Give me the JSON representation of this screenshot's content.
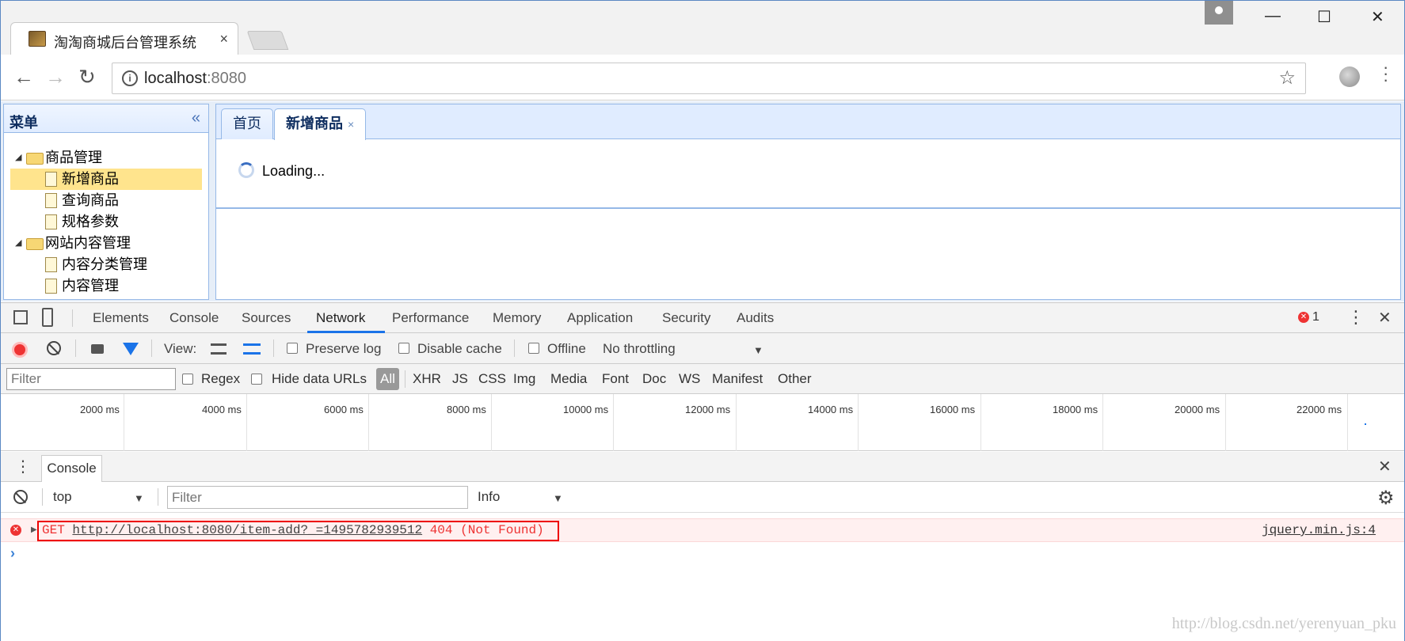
{
  "browser": {
    "tab_title": "淘淘商城后台管理系统",
    "tab_close": "×",
    "url_host": "localhost",
    "url_port": ":8080",
    "star": "☆",
    "back": "←",
    "forward": "→",
    "reload": "↻",
    "minimize": "—",
    "maximize": "☐",
    "close": "✕"
  },
  "sidebar": {
    "title": "菜单",
    "collapse_icon": "«",
    "tree": [
      {
        "label": "商品管理",
        "type": "folder",
        "level": 0,
        "arrow": "◢"
      },
      {
        "label": "新增商品",
        "type": "file",
        "level": 1,
        "selected": true
      },
      {
        "label": "查询商品",
        "type": "file",
        "level": 1
      },
      {
        "label": "规格参数",
        "type": "file",
        "level": 1
      },
      {
        "label": "网站内容管理",
        "type": "folder",
        "level": 0,
        "arrow": "◢"
      },
      {
        "label": "内容分类管理",
        "type": "file",
        "level": 1
      },
      {
        "label": "内容管理",
        "type": "file",
        "level": 1
      }
    ]
  },
  "main": {
    "tabs": [
      {
        "label": "首页",
        "active": false
      },
      {
        "label": "新增商品",
        "active": true,
        "close": "×"
      }
    ],
    "loading_text": "Loading..."
  },
  "devtools": {
    "tabs": [
      "Elements",
      "Console",
      "Sources",
      "Network",
      "Performance",
      "Memory",
      "Application",
      "Security",
      "Audits"
    ],
    "active_tab": "Network",
    "error_count": "1",
    "error_badge": "✕",
    "kebab": "⋮",
    "close": "✕",
    "network_toolbar": {
      "view_label": "View:",
      "preserve_log": "Preserve log",
      "disable_cache": "Disable cache",
      "offline": "Offline",
      "throttling": "No throttling",
      "caret": "▼"
    },
    "filter_bar": {
      "placeholder": "Filter",
      "regex": "Regex",
      "hide_data_urls": "Hide data URLs",
      "types": [
        "All",
        "XHR",
        "JS",
        "CSS",
        "Img",
        "Media",
        "Font",
        "Doc",
        "WS",
        "Manifest",
        "Other"
      ]
    },
    "timeline_ticks": [
      "2000 ms",
      "4000 ms",
      "6000 ms",
      "8000 ms",
      "10000 ms",
      "12000 ms",
      "14000 ms",
      "16000 ms",
      "18000 ms",
      "20000 ms",
      "22000 ms"
    ],
    "drawer": {
      "tab": "Console",
      "context": "top",
      "filter_placeholder": "Filter",
      "level": "Info",
      "caret": "▼",
      "gear": "⚙"
    },
    "console_error": {
      "method": "GET",
      "url": "http://localhost:8080/item-add?_=1495782939512",
      "status": "404 (Not Found)",
      "source": "jquery.min.js:4",
      "expander": "▶"
    },
    "prompt": "›"
  },
  "watermark": "http://blog.csdn.net/yerenyuan_pku"
}
